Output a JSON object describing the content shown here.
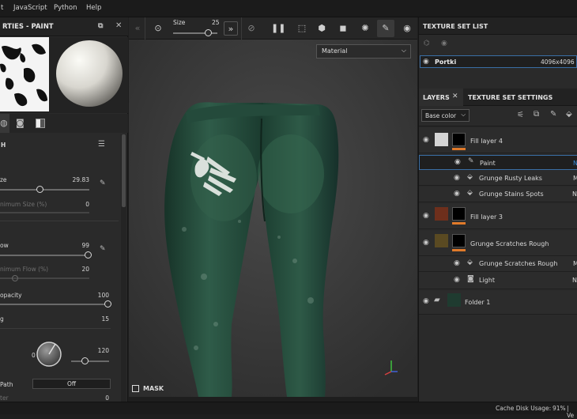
{
  "menubar": {
    "items": [
      "t",
      "JavaScript",
      "Python",
      "Help"
    ]
  },
  "properties": {
    "title": "RTIES - PAINT",
    "brush_header": "H",
    "size": {
      "label": "ze",
      "value": "29.83",
      "level": 0.45
    },
    "min_size": {
      "label": "nimum Size (%)",
      "value": "0"
    },
    "flow": {
      "label": "ow",
      "value": "99",
      "level": 0.99
    },
    "min_flow": {
      "label": "nimum Flow (%)",
      "value": "20"
    },
    "opacity": {
      "label": "opacity",
      "value": "100",
      "level": 1.0
    },
    "spacing": {
      "label": "g",
      "value": "15"
    },
    "angle": {
      "label": "0",
      "value": "120"
    },
    "path": {
      "label": "Path",
      "value": "Off"
    },
    "last_label": "ter",
    "last_value": "0"
  },
  "toolbar": {
    "size_label": "Size",
    "size_value": "25",
    "size_level": 0.8
  },
  "viewport": {
    "dropdown": "Material",
    "mask_label": "MASK"
  },
  "texture_set_list": {
    "title": "TEXTURE SET LIST",
    "set_name": "Portki",
    "set_resolution": "4096x4096"
  },
  "layers_panel": {
    "tab_layers": "LAYERS",
    "tab_settings": "TEXTURE SET SETTINGS",
    "channel_select": "Base color",
    "layers": [
      {
        "name": "Fill layer 4",
        "type": "fill"
      },
      {
        "name": "Paint",
        "type": "effect",
        "tag": "N"
      },
      {
        "name": "Grunge Rusty Leaks",
        "type": "effect",
        "tag": "M"
      },
      {
        "name": "Grunge Stains Spots",
        "type": "effect",
        "tag": "N"
      },
      {
        "name": "Fill layer 3",
        "type": "fill"
      },
      {
        "name": "Grunge Scratches Rough",
        "type": "fill"
      },
      {
        "name": "Grunge Scratches Rough",
        "type": "effect",
        "tag": "M"
      },
      {
        "name": "Light",
        "type": "effect",
        "tag": "N"
      },
      {
        "name": "Folder 1",
        "type": "folder"
      }
    ]
  },
  "statusbar": {
    "cache": "Cache Disk Usage:",
    "percent": "91%",
    "tail": "| Ve"
  },
  "colors": {
    "accent": "#e07a2a",
    "selected_border": "#3a6ea5"
  }
}
